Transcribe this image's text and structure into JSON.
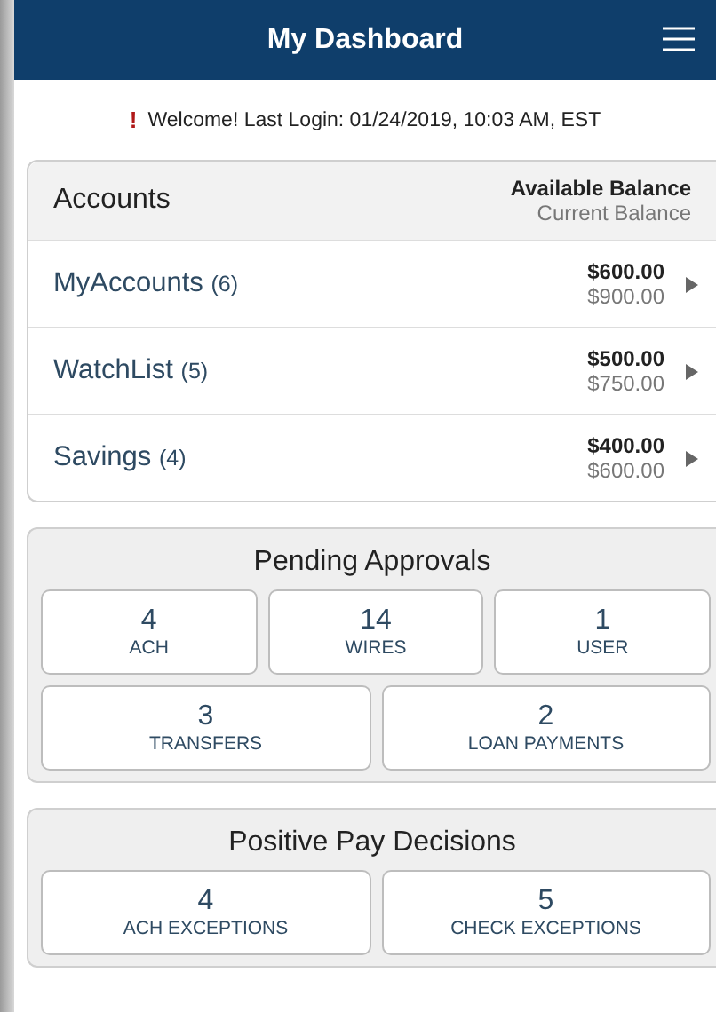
{
  "header": {
    "title": "My Dashboard"
  },
  "welcome": {
    "icon": "!",
    "text": "Welcome! Last Login: 01/24/2019, 10:03 AM, EST"
  },
  "accounts": {
    "title": "Accounts",
    "balance_label": "Available Balance",
    "current_label": "Current Balance",
    "rows": [
      {
        "name": "MyAccounts",
        "count": "(6)",
        "available": "$600.00",
        "current": "$900.00"
      },
      {
        "name": "WatchList",
        "count": "(5)",
        "available": "$500.00",
        "current": "$750.00"
      },
      {
        "name": "Savings",
        "count": "(4)",
        "available": "$400.00",
        "current": "$600.00"
      }
    ]
  },
  "panels": [
    {
      "title": "Pending Approvals",
      "tile_groups": [
        {
          "tiles": [
            {
              "count": "4",
              "label": "ACH"
            },
            {
              "count": "14",
              "label": "WIRES"
            },
            {
              "count": "1",
              "label": "USER"
            }
          ]
        },
        {
          "tiles": [
            {
              "count": "3",
              "label": "TRANSFERS"
            },
            {
              "count": "2",
              "label": "LOAN PAYMENTS"
            }
          ]
        }
      ]
    },
    {
      "title": "Positive Pay Decisions",
      "tile_groups": [
        {
          "tiles": [
            {
              "count": "4",
              "label": "ACH EXCEPTIONS"
            },
            {
              "count": "5",
              "label": "CHECK EXCEPTIONS"
            }
          ]
        }
      ]
    }
  ]
}
